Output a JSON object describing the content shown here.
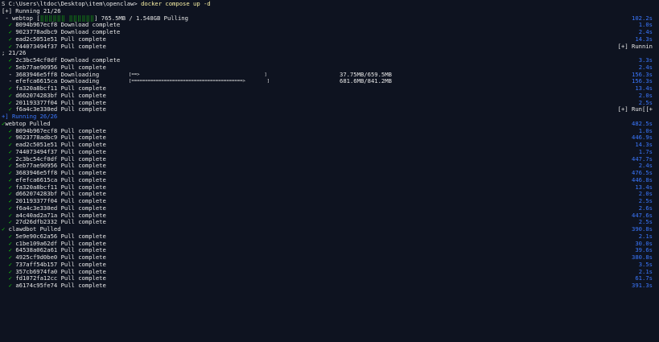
{
  "prompt": {
    "path": "S C:\\Users\\ltdoc\\Desktop\\item\\openclaw>",
    "command": "docker compose up -d"
  },
  "running_header": "[+] Running 21/26",
  "webtop_progress": {
    "prefix": " - webtop [",
    "bar": "⣿⣿⣿⣿⣿⣿ ⣿⣿⣿⣿⣿⣿",
    "suffix": "] 765.5MB / 1.548GB Pulling",
    "time": "102.2s"
  },
  "block1": [
    {
      "id": "8094b967ecf8",
      "status": "Download complete",
      "time": "1.0s"
    },
    {
      "id": "9023778adbc9",
      "status": "Download complete",
      "time": "2.4s"
    },
    {
      "id": "ead2c5051e51",
      "status": "Pull complete",
      "time": "14.3s"
    },
    {
      "id": "744073494f37",
      "status": "Pull complete",
      "time": "[+] Runnin"
    }
  ],
  "counter_line": "; 21/26",
  "block2": [
    {
      "mark": "✓",
      "id": "2c3bc54cf0df",
      "status": "Download complete",
      "extra": "",
      "size": "",
      "time": "3.3s"
    },
    {
      "mark": "✓",
      "id": "5eb77ae90956",
      "status": "Pull complete",
      "extra": "",
      "size": "",
      "time": "2.4s"
    },
    {
      "mark": "-",
      "id": "3683946e5ff8",
      "status": "Downloading",
      "extra": "[==>                                              ]",
      "size": "37.75MB/659.5MB",
      "time": "156.3s"
    },
    {
      "mark": "-",
      "id": "efefca6615ca",
      "status": "Downloading",
      "extra": "[=========================================>        ]",
      "size": "681.6MB/841.2MB",
      "time": "156.3s"
    },
    {
      "mark": "✓",
      "id": "fa320a8bcf11",
      "status": "Pull complete",
      "extra": "",
      "size": "",
      "time": "13.4s"
    },
    {
      "mark": "✓",
      "id": "d662074283bf",
      "status": "Pull complete",
      "extra": "",
      "size": "",
      "time": "2.0s"
    },
    {
      "mark": "✓",
      "id": "201193377f04",
      "status": "Pull complete",
      "extra": "",
      "size": "",
      "time": "2.5s"
    },
    {
      "mark": "✓",
      "id": "f6a4c3e330ed",
      "status": "Pull complete",
      "extra": "",
      "size": "",
      "time": "[+] Run[[+"
    }
  ],
  "running2_header": "+] Running 26/26",
  "webtop_pulled": {
    "label": "webtop Pulled",
    "time": "482.5s"
  },
  "block3": [
    {
      "id": "8094b967ecf8",
      "status": "Pull complete",
      "time": "1.0s"
    },
    {
      "id": "9023778adbc9",
      "status": "Pull complete",
      "time": "446.9s"
    },
    {
      "id": "ead2c5051e51",
      "status": "Pull complete",
      "time": "14.3s"
    },
    {
      "id": "744073494f37",
      "status": "Pull complete",
      "time": "1.7s"
    },
    {
      "id": "2c3bc54cf0df",
      "status": "Pull complete",
      "time": "447.7s"
    },
    {
      "id": "5eb77ae90956",
      "status": "Pull complete",
      "time": "2.4s"
    },
    {
      "id": "3683946e5ff8",
      "status": "Pull complete",
      "time": "476.5s"
    },
    {
      "id": "efefca6615ca",
      "status": "Pull complete",
      "time": "446.8s"
    },
    {
      "id": "fa320a8bcf11",
      "status": "Pull complete",
      "time": "13.4s"
    },
    {
      "id": "d662074283bf",
      "status": "Pull complete",
      "time": "2.0s"
    },
    {
      "id": "201193377f04",
      "status": "Pull complete",
      "time": "2.5s"
    },
    {
      "id": "f6a4c3e330ed",
      "status": "Pull complete",
      "time": "2.6s"
    },
    {
      "id": "a4c40ad2a71a",
      "status": "Pull complete",
      "time": "447.6s"
    },
    {
      "id": "27d26dfb2332",
      "status": "Pull complete",
      "time": "2.5s"
    }
  ],
  "clawdbot_pulled": {
    "label": "clawdbot Pulled",
    "time": "390.8s"
  },
  "block4": [
    {
      "id": "5e9e90c62a56",
      "status": "Pull complete",
      "time": "2.1s"
    },
    {
      "id": "c1be109a62df",
      "status": "Pull complete",
      "time": "30.0s"
    },
    {
      "id": "64538a062a61",
      "status": "Pull complete",
      "time": "39.6s"
    },
    {
      "id": "4925cf9d0be0",
      "status": "Pull complete",
      "time": "380.8s"
    },
    {
      "id": "737aff54b157",
      "status": "Pull complete",
      "time": "3.5s"
    },
    {
      "id": "357cb6974fa0",
      "status": "Pull complete",
      "time": "2.1s"
    },
    {
      "id": "fd1072fa12cc",
      "status": "Pull complete",
      "time": "61.7s"
    },
    {
      "id": "a6174c95fe74",
      "status": "Pull complete",
      "time": "391.3s"
    }
  ],
  "colors": {
    "background": "#0e1320",
    "check": "#16c60c",
    "time": "#3b78ff",
    "command": "#f9f1a5"
  }
}
